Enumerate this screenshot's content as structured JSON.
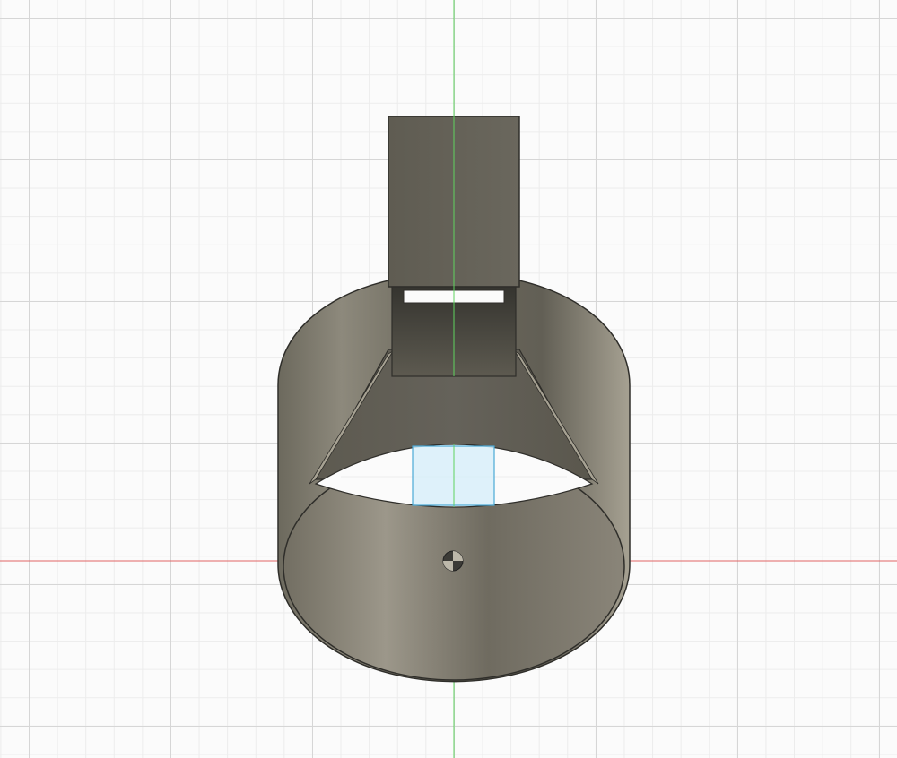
{
  "app": {
    "view": "canvas-3d-viewport"
  },
  "colors": {
    "background": "#fbfbfb",
    "grid_major": "#d6d6d6",
    "grid_minor": "#ececec",
    "x_axis": "#e06666",
    "y_axis": "#5fd35f",
    "body_dark": "#5e5b50",
    "body_mid": "#7a766a",
    "body_light": "#9e9989",
    "edge": "#2f2e2a",
    "selection_fill": "#d8eef9",
    "selection_edge": "#4aa9d6"
  },
  "icons": {
    "origin": "origin-marker-icon"
  }
}
